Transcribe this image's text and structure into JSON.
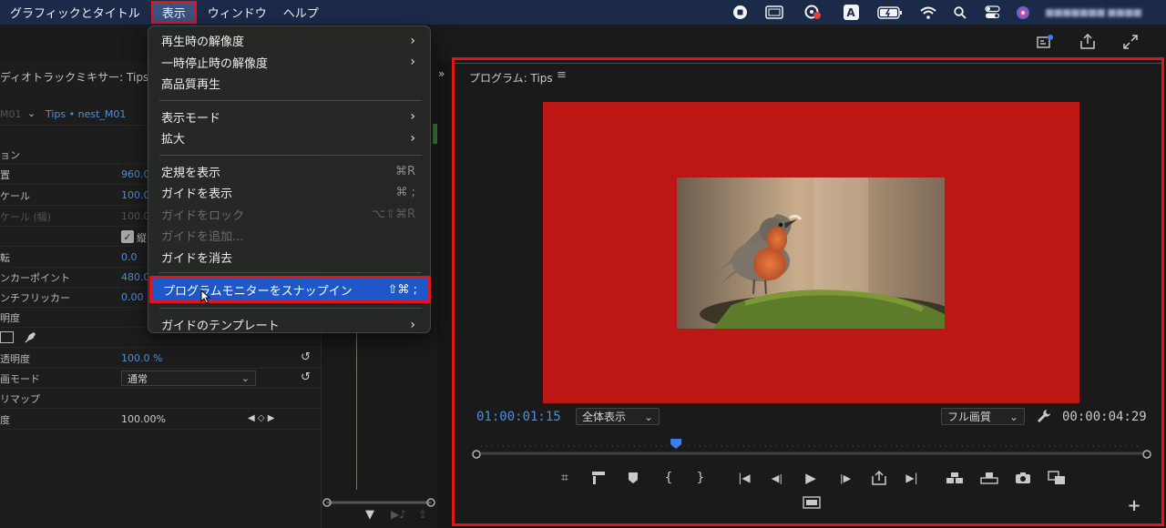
{
  "menubar": {
    "items": [
      "グラフィックとタイトル",
      "表示",
      "ウィンドウ",
      "ヘルプ"
    ],
    "active_index": 1,
    "input_mode": "A",
    "user_redacted": "■■■■■■■ ■■■■"
  },
  "dropdown": {
    "groups": [
      [
        {
          "label": "再生時の解像度",
          "submenu": true
        },
        {
          "label": "一時停止時の解像度",
          "submenu": true
        },
        {
          "label": "高品質再生"
        }
      ],
      [
        {
          "label": "表示モード",
          "submenu": true
        },
        {
          "label": "拡大",
          "submenu": true
        }
      ],
      [
        {
          "label": "定規を表示",
          "shortcut": "⌘R"
        },
        {
          "label": "ガイドを表示",
          "shortcut": "⌘ ;"
        },
        {
          "label": "ガイドをロック",
          "shortcut": "⌥⇧⌘R",
          "disabled": true
        },
        {
          "label": "ガイドを追加...",
          "disabled": true
        },
        {
          "label": "ガイドを消去"
        }
      ],
      [
        {
          "label": "プログラムモニターをスナップイン",
          "shortcut": "⇧⌘ ;",
          "highlighted": true
        }
      ],
      [
        {
          "label": "ガイドのテンプレート",
          "submenu": true
        }
      ]
    ],
    "submenu_arrow": "›"
  },
  "left_panel": {
    "header": "ディオトラックミキサー: Tips",
    "sequence_prefix": "M01",
    "sequence": "Tips • nest_M01",
    "rows": [
      {
        "label": "ョン",
        "value": ""
      },
      {
        "label": "置",
        "value": "960.0"
      },
      {
        "label": "ケール",
        "value": "100.0"
      },
      {
        "label": "ケール (幅)",
        "value": "100.0",
        "disabled": true
      },
      {
        "label": "",
        "value": "縦"
      },
      {
        "label": "転",
        "value": "0.0"
      },
      {
        "label": "ンカーポイント",
        "value": "480.0"
      },
      {
        "label": "ンチフリッカー",
        "value": "0.00"
      },
      {
        "label": "明度",
        "value": ""
      },
      {
        "label": "",
        "value": ""
      },
      {
        "label": "透明度",
        "value": "100.0 %"
      },
      {
        "label": "画モード",
        "value": "通常"
      },
      {
        "label": "リマップ",
        "value": ""
      },
      {
        "label": "度",
        "value": "100.00%"
      }
    ]
  },
  "program_monitor": {
    "title": "プログラム: Tips",
    "timecode_current": "01:00:01:15",
    "zoom": "全体表示",
    "quality": "フル画質",
    "timecode_duration": "00:00:04:29",
    "playhead_fraction": 0.295,
    "colors": {
      "frame": "#bc1615",
      "timecode": "#4a8fe0",
      "highlight": "#e0161b"
    }
  }
}
